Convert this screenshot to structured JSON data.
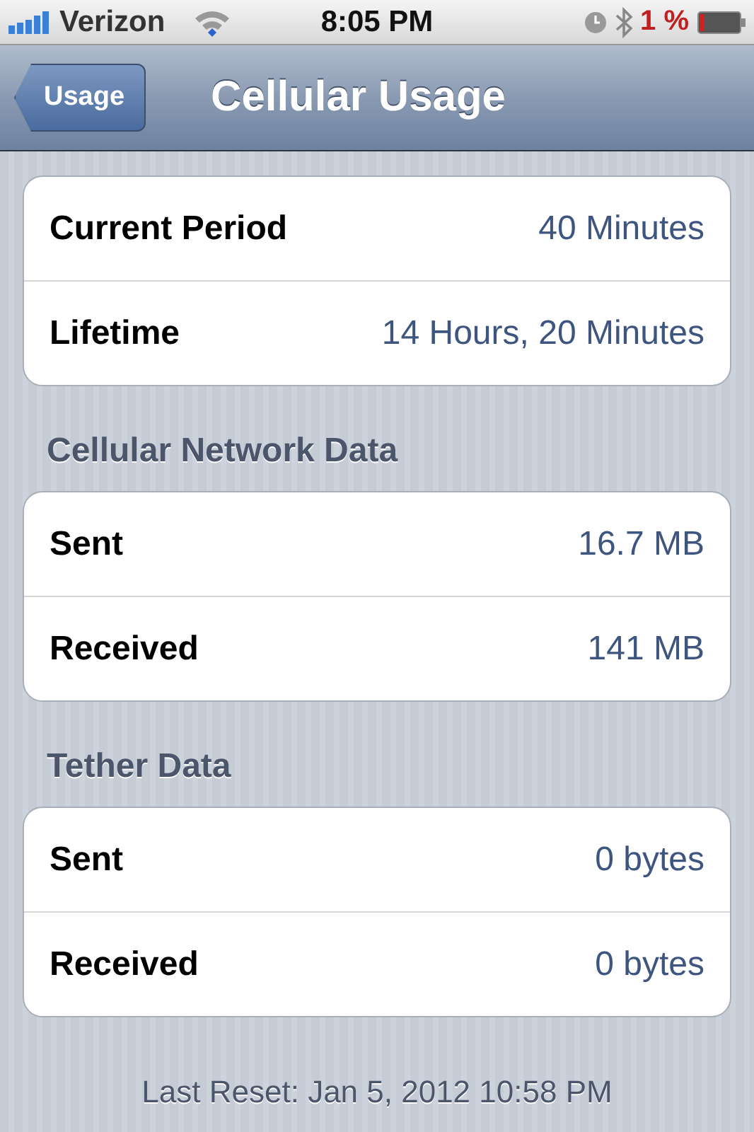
{
  "status_bar": {
    "carrier": "Verizon",
    "time": "8:05 PM",
    "battery": "1 %"
  },
  "nav_bar": {
    "back_button": "Usage",
    "title": "Cellular Usage"
  },
  "sections": [
    {
      "rows": [
        {
          "label": "Current Period",
          "value": "40 Minutes"
        },
        {
          "label": "Lifetime",
          "value": "14 Hours, 20 Minutes"
        }
      ]
    },
    {
      "header": "Cellular Network Data",
      "rows": [
        {
          "label": "Sent",
          "value": "16.7 MB"
        },
        {
          "label": "Received",
          "value": "141 MB"
        }
      ]
    },
    {
      "header": "Tether Data",
      "rows": [
        {
          "label": "Sent",
          "value": "0 bytes"
        },
        {
          "label": "Received",
          "value": "0 bytes"
        }
      ]
    }
  ],
  "footer": "Last Reset: Jan 5, 2012 10:58 PM"
}
